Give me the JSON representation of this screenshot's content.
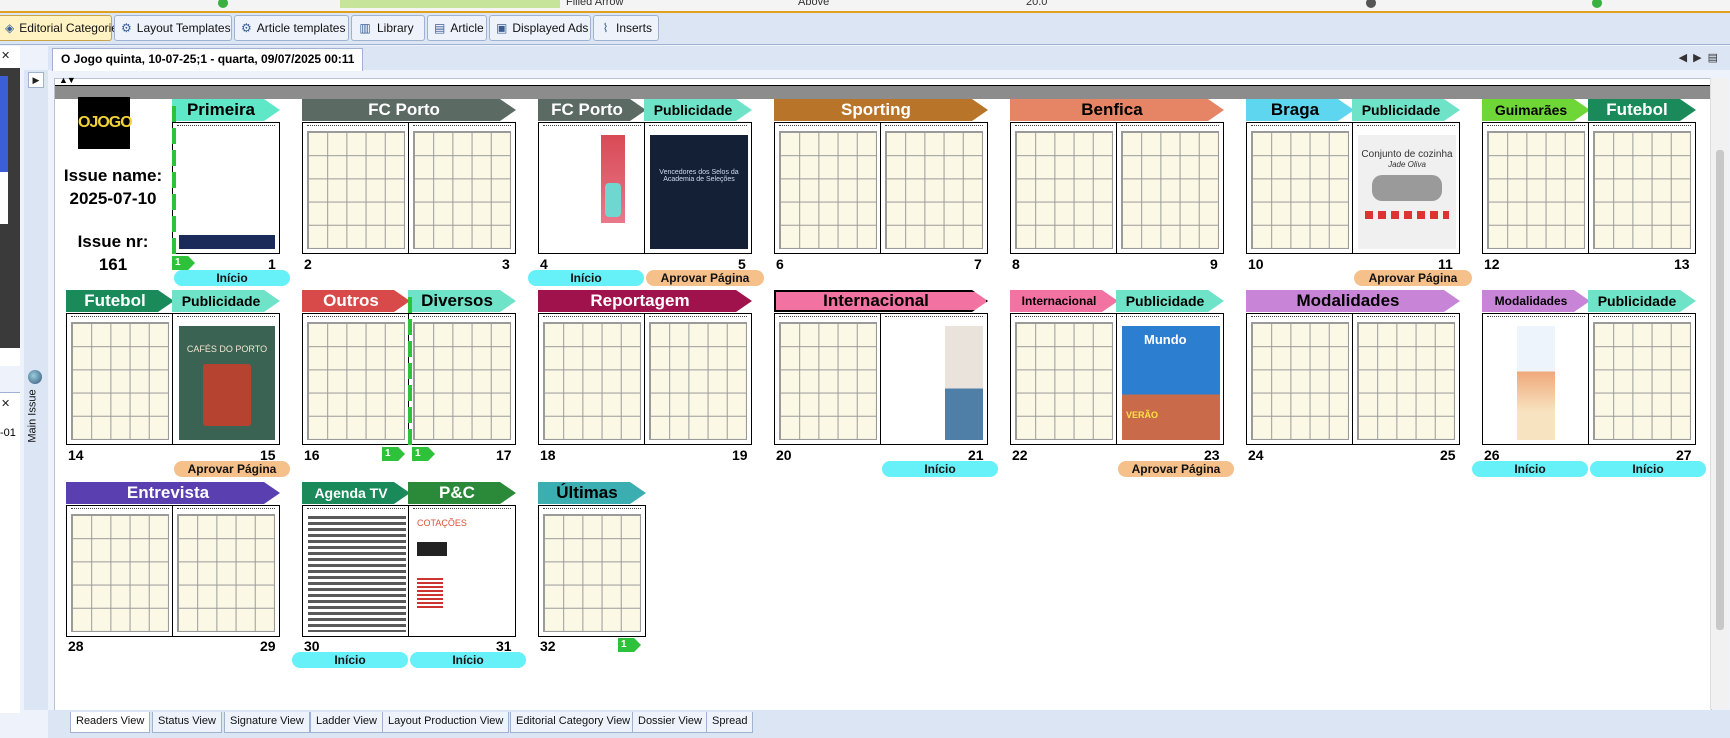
{
  "top_strip": {
    "items": [
      "Filled Arrow",
      "Above",
      "20.0"
    ]
  },
  "toolbar": {
    "buttons": [
      {
        "label": "Editorial Categories",
        "icon": "category-icon",
        "active": true
      },
      {
        "label": "Layout Templates",
        "icon": "gear-icon",
        "active": false
      },
      {
        "label": "Article templates",
        "icon": "gear-icon",
        "active": false
      },
      {
        "label": "Library",
        "icon": "library-icon",
        "active": false
      },
      {
        "label": "Article",
        "icon": "document-icon",
        "active": false
      },
      {
        "label": "Displayed Ads",
        "icon": "image-icon",
        "active": false
      },
      {
        "label": "Inserts",
        "icon": "paperclip-icon",
        "active": false
      }
    ]
  },
  "document_tab": {
    "title": "O Jogo  quinta, 10-07-25;1 - quarta, 09/07/2025 00:11"
  },
  "side": {
    "main_issue_label": "Main Issue",
    "left_fragment": "-01"
  },
  "issue": {
    "logo_text": "OJOGO",
    "name_label": "Issue name:",
    "name_value": "2025-07-10",
    "nr_label": "Issue nr:",
    "nr_value": "161"
  },
  "colors": {
    "inicio": "#66f0f7",
    "aprovar": "#f6c08a",
    "marker": "#2ec23a"
  },
  "categories": [
    {
      "label": "Primeira",
      "color": "#5fe8c8",
      "text": "#000"
    },
    {
      "label": "FC Porto",
      "color": "#5b6b64",
      "text": "#fff"
    },
    {
      "label": "FC Porto",
      "color": "#5b6b64",
      "text": "#fff"
    },
    {
      "label": "Publicidade",
      "color": "#6fe3c8",
      "text": "#000"
    },
    {
      "label": "Sporting",
      "color": "#b87428",
      "text": "#fff"
    },
    {
      "label": "Benfica",
      "color": "#e58566",
      "text": "#000"
    },
    {
      "label": "Braga",
      "color": "#5fd6f0",
      "text": "#000"
    },
    {
      "label": "Publicidade",
      "color": "#6fe3c8",
      "text": "#000"
    },
    {
      "label": "Guimarães",
      "color": "#6ed636",
      "text": "#000"
    },
    {
      "label": "Futebol",
      "color": "#1a8a5a",
      "text": "#fff"
    },
    {
      "label": "Futebol",
      "color": "#1a8a5a",
      "text": "#fff"
    },
    {
      "label": "Publicidade",
      "color": "#6fe3c8",
      "text": "#000"
    },
    {
      "label": "Outros",
      "color": "#d84a4a",
      "text": "#fff"
    },
    {
      "label": "Diversos",
      "color": "#6fe3c8",
      "text": "#000"
    },
    {
      "label": "Reportagem",
      "color": "#a0124c",
      "text": "#fff"
    },
    {
      "label": "Internacional",
      "color": "#f272a2",
      "text": "#000"
    },
    {
      "label": "Internacional",
      "color": "#f272a2",
      "text": "#000"
    },
    {
      "label": "Publicidade",
      "color": "#6fe3c8",
      "text": "#000"
    },
    {
      "label": "Modalidades",
      "color": "#c885d8",
      "text": "#000"
    },
    {
      "label": "Modalidades",
      "color": "#c885d8",
      "text": "#000"
    },
    {
      "label": "Publicidade",
      "color": "#6fe3c8",
      "text": "#000"
    },
    {
      "label": "Entrevista",
      "color": "#5a3fb0",
      "text": "#fff"
    },
    {
      "label": "Agenda TV",
      "color": "#1a8a5a",
      "text": "#fff"
    },
    {
      "label": "P&C",
      "color": "#2a8a3a",
      "text": "#fff"
    },
    {
      "label": "Últimas",
      "color": "#3aaeb0",
      "text": "#000"
    }
  ],
  "pages": [
    "1",
    "2",
    "3",
    "4",
    "5",
    "6",
    "7",
    "8",
    "9",
    "10",
    "11",
    "12",
    "13",
    "14",
    "15",
    "16",
    "17",
    "18",
    "19",
    "20",
    "21",
    "22",
    "23",
    "24",
    "25",
    "26",
    "27",
    "28",
    "29",
    "30",
    "31",
    "32"
  ],
  "status_pills": [
    {
      "page": "1",
      "label": "Início",
      "type": "inicio"
    },
    {
      "page": "4",
      "label": "Início",
      "type": "inicio"
    },
    {
      "page": "5",
      "label": "Aprovar Página",
      "type": "aprovar"
    },
    {
      "page": "11",
      "label": "Aprovar Página",
      "type": "aprovar"
    },
    {
      "page": "15",
      "label": "Aprovar Página",
      "type": "aprovar"
    },
    {
      "page": "21",
      "label": "Início",
      "type": "inicio"
    },
    {
      "page": "23",
      "label": "Aprovar Página",
      "type": "aprovar"
    },
    {
      "page": "26",
      "label": "Início",
      "type": "inicio"
    },
    {
      "page": "27",
      "label": "Início",
      "type": "inicio"
    },
    {
      "page": "30",
      "label": "Início",
      "type": "inicio"
    },
    {
      "page": "31",
      "label": "Início",
      "type": "inicio"
    }
  ],
  "markers": [
    {
      "page": "1",
      "label": "1"
    },
    {
      "page": "16",
      "label": "1"
    },
    {
      "page": "17",
      "label": "1"
    },
    {
      "page": "32",
      "label": "1"
    }
  ],
  "ad_texts": {
    "p5_heading": "Vencedores dos Selos da Academia de Seleções",
    "p11_heading": "Conjunto de cozinha",
    "p11_sub": "Jade Oliva",
    "p15_heading": "CAFÉS DO PORTO",
    "p23_heading": "Mundo",
    "p23_sub": "VERÃO",
    "p31_heading": "COTAÇÕES"
  },
  "bottom_tabs": [
    {
      "label": "Readers View",
      "active": true
    },
    {
      "label": "Status View",
      "active": false
    },
    {
      "label": "Signature View",
      "active": false
    },
    {
      "label": "Ladder View",
      "active": false
    },
    {
      "label": "Layout Production View",
      "active": false
    },
    {
      "label": "Editorial Category View",
      "active": false
    },
    {
      "label": "Dossier View",
      "active": false
    },
    {
      "label": "Spread",
      "active": false
    }
  ]
}
